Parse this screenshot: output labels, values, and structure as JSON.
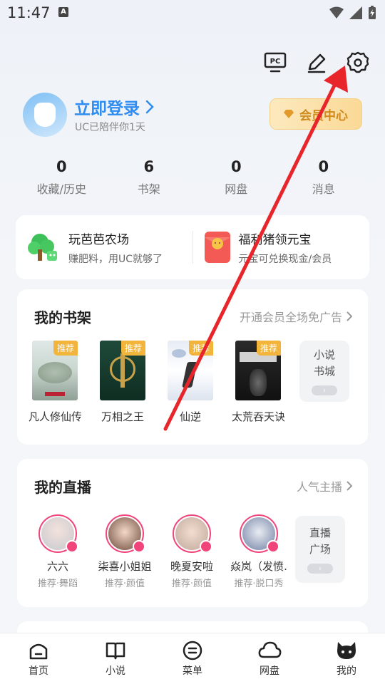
{
  "status_bar": {
    "time": "11:47",
    "notification_icon": "A"
  },
  "top_icons": [
    "pc-icon",
    "edit-icon",
    "settings-icon"
  ],
  "profile": {
    "login_label": "立即登录",
    "subtitle": "UC已陪伴你1天",
    "vip_label": "会员中心"
  },
  "stats": [
    {
      "value": "0",
      "label": "收藏/历史"
    },
    {
      "value": "6",
      "label": "书架"
    },
    {
      "value": "0",
      "label": "网盘"
    },
    {
      "value": "0",
      "label": "消息"
    }
  ],
  "promo": [
    {
      "title": "玩芭芭农场",
      "subtitle": "赚肥料，用UC就够了"
    },
    {
      "title": "福利猪领元宝",
      "subtitle": "元宝可兑换现金/会员"
    }
  ],
  "bookshelf": {
    "title": "我的书架",
    "link": "开通会员全场免广告",
    "books": [
      {
        "name": "凡人修仙传",
        "tag": "推荐"
      },
      {
        "name": "万相之王",
        "tag": "推荐"
      },
      {
        "name": "仙逆",
        "tag": "推荐"
      },
      {
        "name": "太荒吞天诀",
        "tag": "推荐"
      }
    ],
    "more_line1": "小说",
    "more_line2": "书城"
  },
  "live": {
    "title": "我的直播",
    "link": "人气主播",
    "streamers": [
      {
        "name": "六六",
        "sub": "推荐·舞蹈"
      },
      {
        "name": "柒喜小姐姐",
        "sub": "推荐·颜值"
      },
      {
        "name": "晚夏安啦",
        "sub": "推荐·颜值"
      },
      {
        "name": "焱岚（发愤…",
        "sub": "推荐·脱口秀"
      }
    ],
    "more_line1": "直播",
    "more_line2": "广场"
  },
  "bottom_nav": [
    {
      "label": "首页",
      "icon": "home-icon"
    },
    {
      "label": "小说",
      "icon": "book-icon"
    },
    {
      "label": "菜单",
      "icon": "menu-icon"
    },
    {
      "label": "网盘",
      "icon": "cloud-icon"
    },
    {
      "label": "我的",
      "icon": "profile-icon"
    }
  ],
  "colors": {
    "accent_blue": "#2f8cf0",
    "vip_gold": "#d08a1e",
    "live_pink": "#f0447a",
    "tag_orange": "#f2b43a",
    "annotation_red": "#e8252a"
  }
}
